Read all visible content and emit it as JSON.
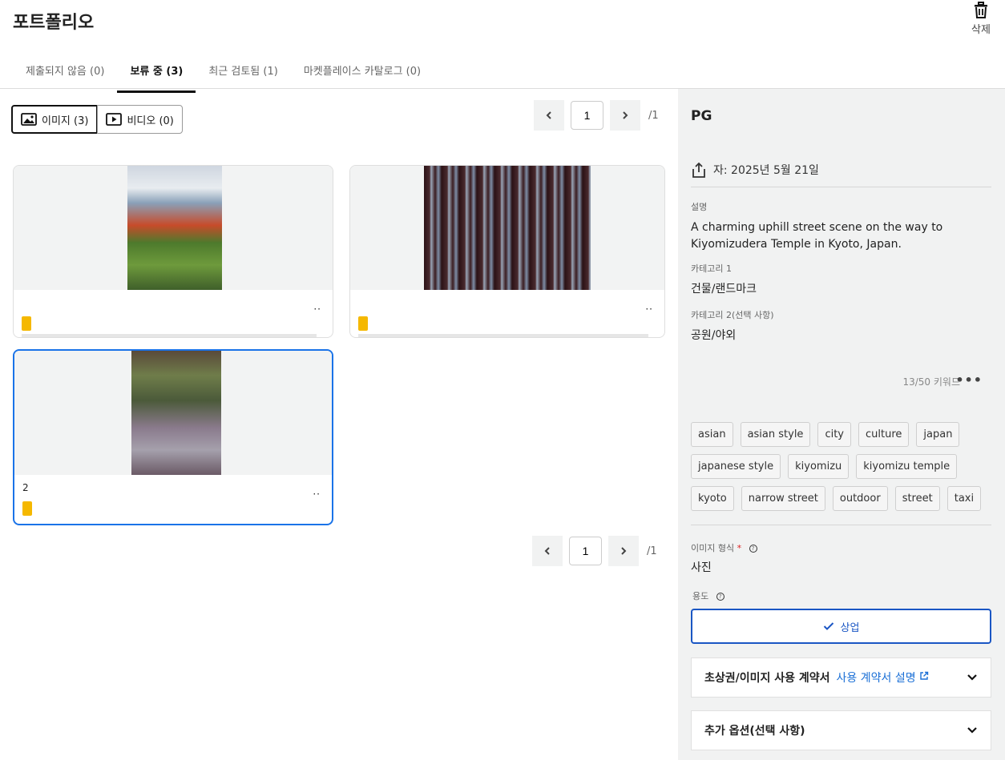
{
  "header": {
    "title": "포트폴리오",
    "delete_label": "삭제"
  },
  "tabs": [
    {
      "label": "제출되지 않음 (0)",
      "active": false
    },
    {
      "label": "보류 중 (3)",
      "active": true
    },
    {
      "label": "최근 검토됨 (1)",
      "active": false
    },
    {
      "label": "마켓플레이스 카탈로그 (0)",
      "active": false
    }
  ],
  "media_toggle": {
    "images": "이미지 (3)",
    "videos": "비디오 (0)"
  },
  "pager": {
    "page": "1",
    "total": "/1"
  },
  "cards": [
    {
      "filename": "",
      "badge": "",
      "more": "··"
    },
    {
      "filename": "",
      "badge": "",
      "more": "··"
    },
    {
      "filename": "2",
      "badge": "",
      "more": "··"
    }
  ],
  "detail": {
    "filename": "PG",
    "date_text": "자: 2025년 5월 21일",
    "description_label": "설명",
    "description": "A charming uphill street scene on the way to Kiyomizudera Temple in Kyoto, Japan.",
    "category1_label": "카테고리 1",
    "category1": "건물/랜드마크",
    "category2_label": "카테고리 2(선택 사항)",
    "category2": "공원/야외",
    "keyword_count": "13/50 키워드",
    "keywords": [
      "asian",
      "asian style",
      "city",
      "culture",
      "japan",
      "japanese style",
      "kiyomizu",
      "kiyomizu temple",
      "kyoto",
      "narrow street",
      "outdoor",
      "street",
      "taxi"
    ],
    "image_format_label": "이미지 형식",
    "image_format_required": "*",
    "image_format": "사진",
    "usage_label": "용도",
    "usage_value": "상업",
    "accordion1_title": "초상권/이미지 사용 계약서",
    "accordion1_link": "사용 계약서 설명",
    "accordion2_title": "추가 옵션(선택 사항)"
  }
}
